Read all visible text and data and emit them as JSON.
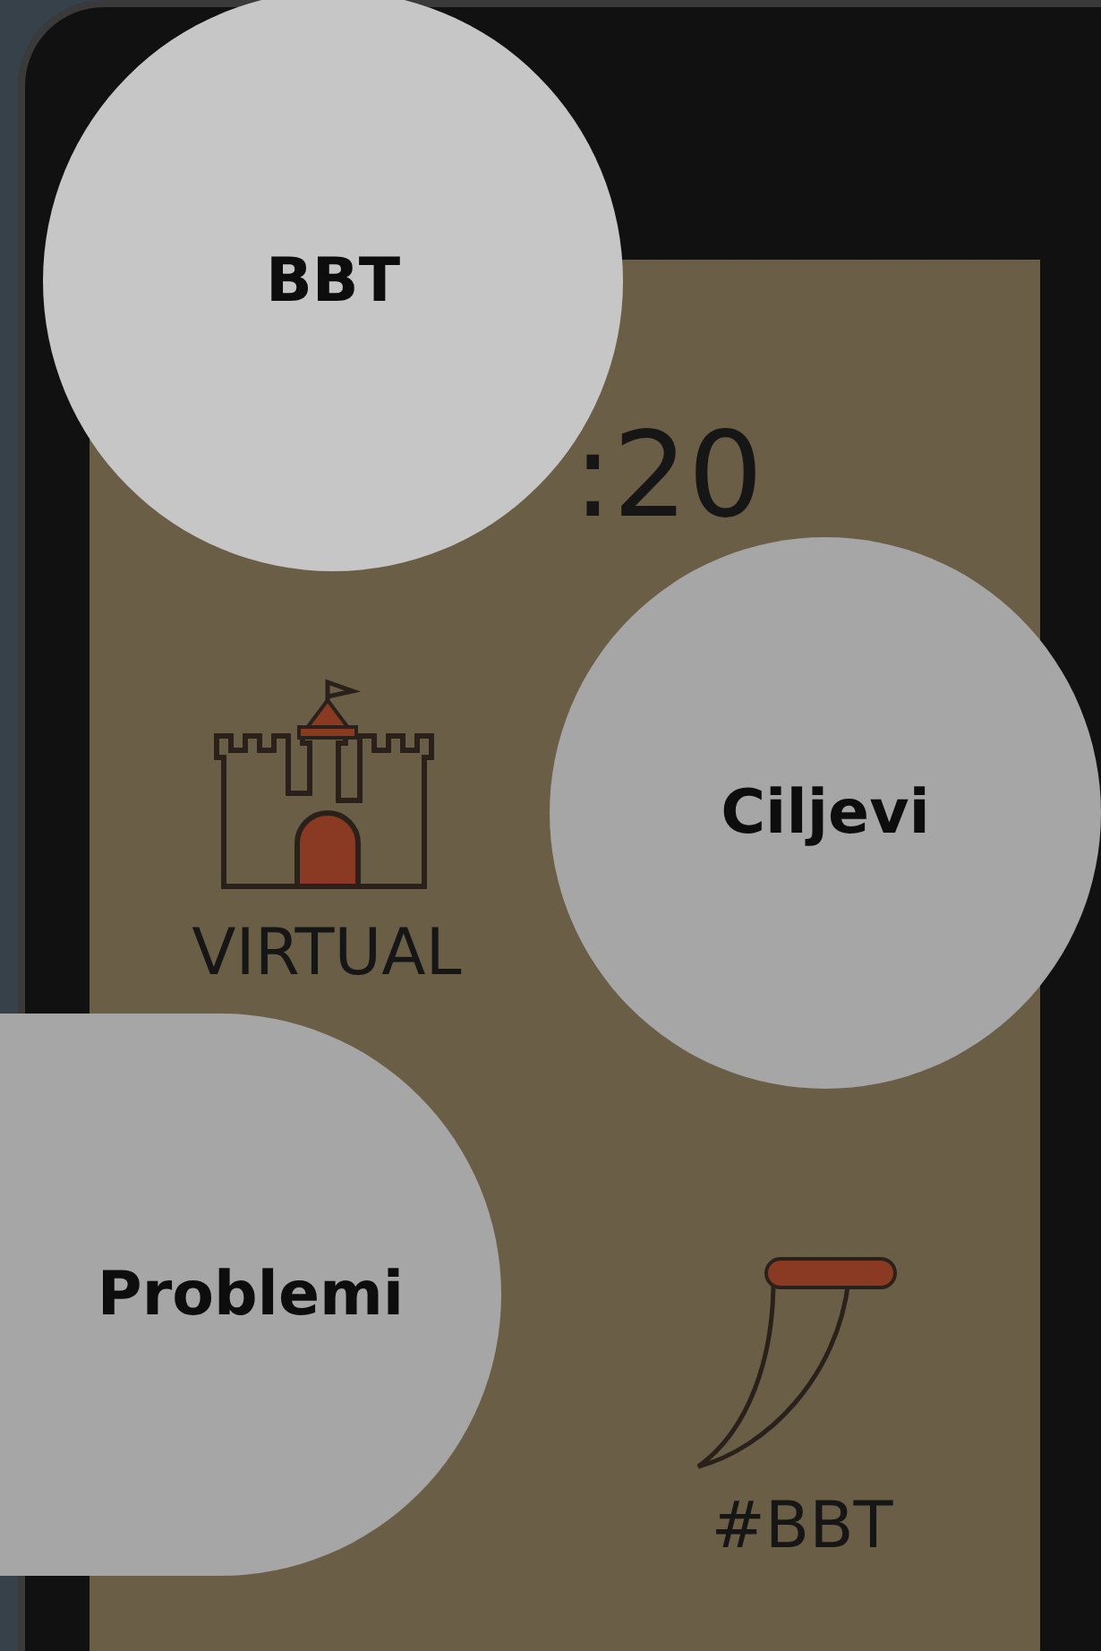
{
  "phone_screen": {
    "time": ":20",
    "tiles": [
      {
        "kind": "castle",
        "label": "VIRTUAL"
      },
      {
        "kind": "covered"
      },
      {
        "kind": "covered"
      },
      {
        "kind": "horn",
        "label": "#BBT"
      }
    ]
  },
  "overlay_bubbles": [
    {
      "kind": "light",
      "label": "BBT"
    },
    {
      "kind": "mid",
      "label": "Ciljevi"
    },
    {
      "kind": "mid",
      "label": "Problemi"
    }
  ]
}
